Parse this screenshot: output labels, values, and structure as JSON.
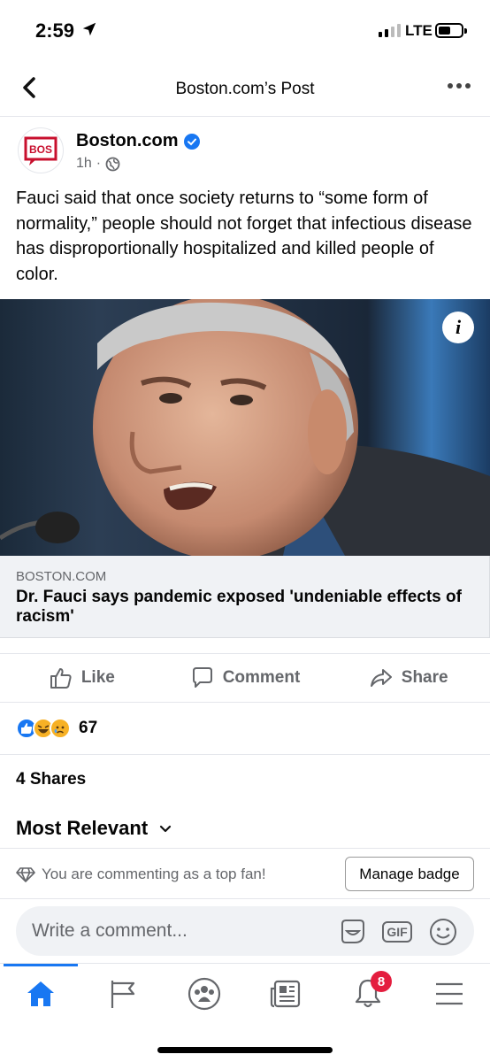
{
  "status_bar": {
    "time": "2:59",
    "network": "LTE"
  },
  "topbar": {
    "title": "Boston.com’s Post"
  },
  "post": {
    "author": "Boston.com",
    "avatar_text": "BOS",
    "timestamp": "1h",
    "separator": "·",
    "text": "Fauci said that once society returns to “some form of normality,” people should not forget that infectious disease has disproportionally hospitalized and killed people of color.",
    "info_icon": "i"
  },
  "link": {
    "domain": "BOSTON.COM",
    "title": "Dr. Fauci says pandemic exposed 'undeniable effects of racism'"
  },
  "actions": {
    "like": "Like",
    "comment": "Comment",
    "share": "Share"
  },
  "reactions": {
    "count": "67",
    "types": [
      "like-icon",
      "haha-icon",
      "sad-icon"
    ]
  },
  "shares": "4 Shares",
  "sort": {
    "label": "Most Relevant"
  },
  "fan": {
    "text": "You are commenting as a top fan!",
    "button": "Manage badge"
  },
  "comment_box": {
    "placeholder": "Write a comment...",
    "gif": "GIF"
  },
  "tabbar": {
    "notifications_count": "8",
    "tabs": [
      "home-icon",
      "pages-flag-icon",
      "groups-icon",
      "news-icon",
      "notifications-bell-icon",
      "menu-icon"
    ]
  },
  "colors": {
    "accent": "#1877f2",
    "badge": "#e41e3f",
    "bos_red": "#c8102e"
  }
}
